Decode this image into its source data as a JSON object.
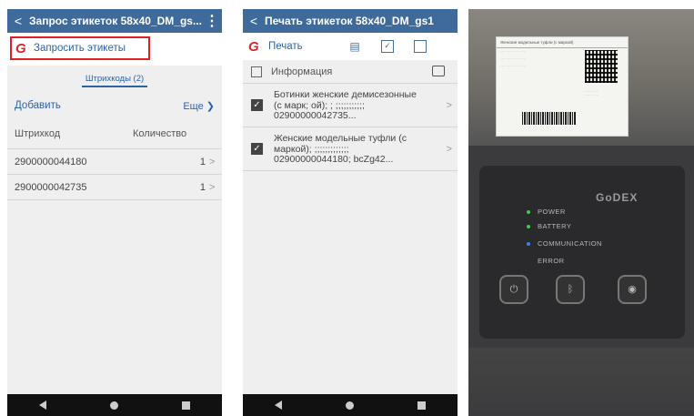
{
  "screen1": {
    "title": "Запрос этикеток 58х40_DM_gs...",
    "request_button": "Запросить этикеты",
    "tab": "Штрихкоды (2)",
    "add": "Добавить",
    "more": "Еще",
    "col_barcode": "Штрихкод",
    "col_qty": "Количество",
    "rows": [
      {
        "barcode": "2900000044180",
        "qty": "1"
      },
      {
        "barcode": "2900000042735",
        "qty": "1"
      }
    ]
  },
  "screen2": {
    "title": "Печать этикеток 58х40_DM_gs1",
    "print_button": "Печать",
    "info_header": "Информация",
    "items": [
      {
        "text": "Ботинки женские демисезонные (с марк; ой); ; ;;;;;;;;;;; 02900000042735..."
      },
      {
        "text": "Женские модельные туфли (с маркой); ;;;;;;;;;;;;; 02900000044180; bcZg42..."
      }
    ]
  },
  "photo": {
    "label_title": "Женские модельные туфли (с маркой)",
    "brand": "GoDEX",
    "leds": [
      {
        "label": "POWER",
        "color": "#3ecf4a"
      },
      {
        "label": "BATTERY",
        "color": "#3ecf4a"
      },
      {
        "label": "COMMUNICATION",
        "color": "#3a7cff"
      },
      {
        "label": "ERROR",
        "color": "#2a2a2c"
      }
    ]
  },
  "colors": {
    "appbar": "#3f6a9c",
    "accent": "#2e62a6",
    "highlight": "#e02020",
    "brand_red": "#d8262e"
  }
}
